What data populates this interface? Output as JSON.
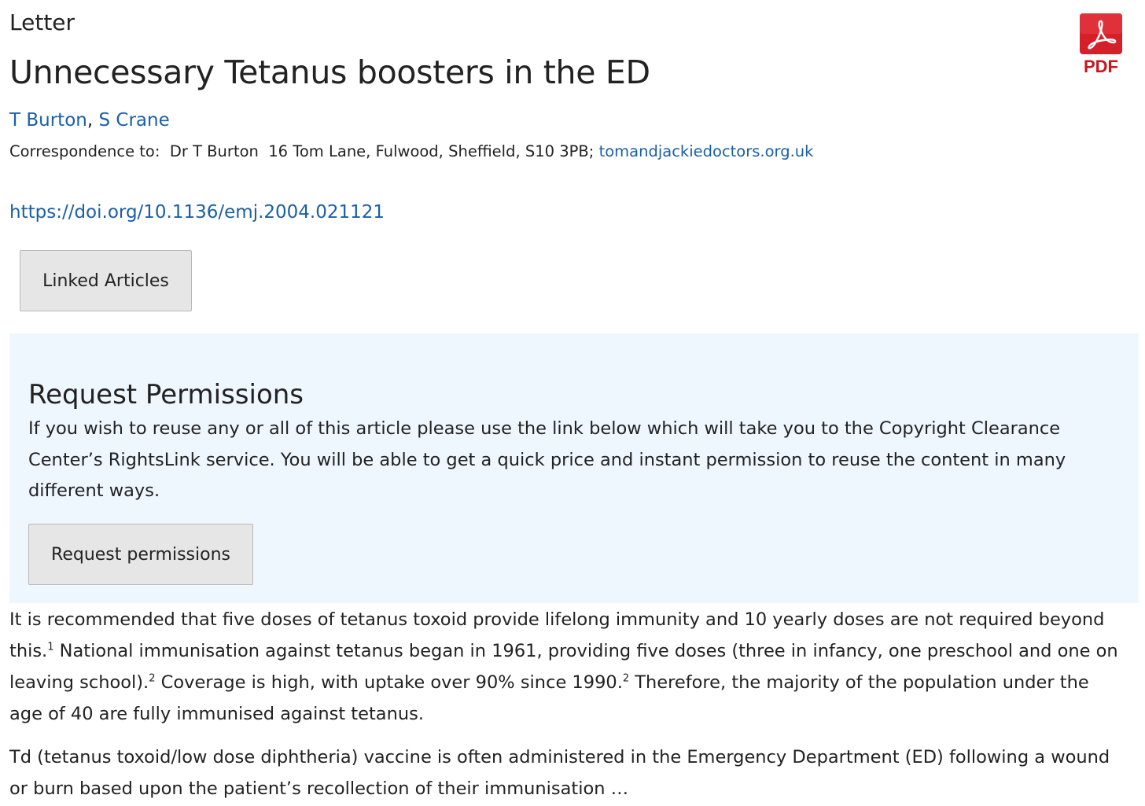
{
  "article": {
    "section_type": "Letter",
    "title": "Unnecessary Tetanus boosters in the ED",
    "authors": [
      "T Burton",
      "S Crane"
    ],
    "author_separator": ",",
    "correspondence_label": "Correspondence to:",
    "correspondence_text": "Dr T Burton  16 Tom Lane, Fulwood, Sheffield, S10 3PB;",
    "correspondence_email": "tomandjackiedoctors.org.uk",
    "doi": "https://doi.org/10.1136/emj.2004.021121"
  },
  "buttons": {
    "linked_articles": "Linked Articles",
    "request_permissions": "Request permissions"
  },
  "pdf": {
    "label": "PDF",
    "icon": "pdf-icon",
    "color": "#c8161d"
  },
  "permissions": {
    "heading": "Request Permissions",
    "text": "If you wish to reuse any or all of this article please use the link below which will take you to the Copyright Clearance Center’s RightsLink service. You will be able to get a quick price and instant permission to reuse the content in many different ways."
  },
  "body": {
    "p1_a": "It is recommended that five doses of tetanus toxoid provide lifelong immunity and 10 yearly doses are not required beyond this.",
    "p1_ref1": "1",
    "p1_b": " National immunisation against tetanus began in 1961, providing five doses (three in infancy, one preschool and one on leaving school).",
    "p1_ref2": "2",
    "p1_c": " Coverage is high, with uptake over 90% since 1990.",
    "p1_ref3": "2",
    "p1_d": " Therefore, the majority of the population under the age of 40 are fully immunised against tetanus.",
    "p2": "Td (tetanus toxoid/low dose diphtheria) vaccine is often administered in the Emergency Department (ED) following a wound or burn based upon the patient’s recollection of their immunisation …"
  },
  "colors": {
    "link": "#1a5fa8",
    "permissions_background": "#eef6fe",
    "button_background": "#e6e6e6"
  }
}
